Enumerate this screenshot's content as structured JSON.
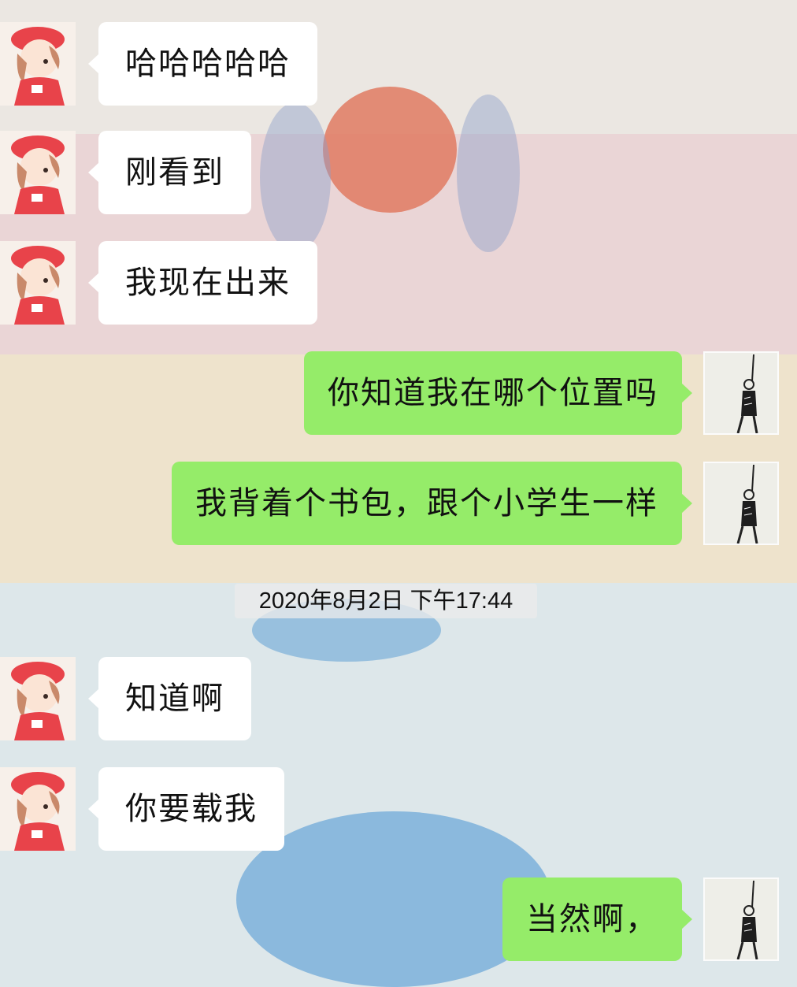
{
  "chat": {
    "messages": [
      {
        "side": "in",
        "text": "哈哈哈哈哈"
      },
      {
        "side": "in",
        "text": "刚看到"
      },
      {
        "side": "in",
        "text": "我现在出来"
      },
      {
        "side": "out",
        "text": "你知道我在哪个位置吗"
      },
      {
        "side": "out",
        "text": "我背着个书包，跟个小学生一样"
      },
      {
        "side": "in",
        "text": "知道啊"
      },
      {
        "side": "in",
        "text": "你要载我"
      },
      {
        "side": "out",
        "text": "当然啊，"
      }
    ],
    "timestamp": "2020年8月2日 下午17:44"
  },
  "colors": {
    "incoming_bubble": "#ffffff",
    "outgoing_bubble": "#95ec69"
  },
  "icons": {
    "contact_avatar": "girl-red-beret-avatar",
    "my_avatar": "sketch-figure-avatar"
  }
}
